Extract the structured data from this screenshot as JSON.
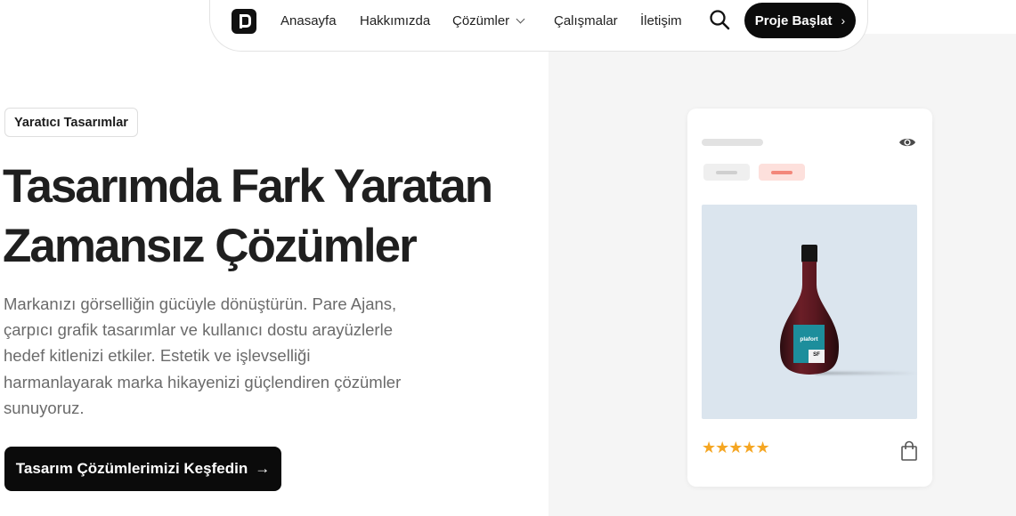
{
  "nav": {
    "links": [
      "Anasayfa",
      "Hakkımızda",
      "Çözümler",
      "Çalışmalar",
      "İletişim"
    ],
    "cta_label": "Proje Başlat",
    "cta_arrow": "›"
  },
  "hero": {
    "badge": "Yaratıcı Tasarımlar",
    "headline_line1": "Tasarımda Fark Yaratan",
    "headline_line2": "Zamansız Çözümler",
    "description": "Markanızı görselliğin gücüyle dönüştürün. Pare Ajans, çarpıcı grafik tasarımlar ve kullanıcı dostu arayüzlerle hedef kitlenizi etkiler. Estetik ve işlevselliği harmanlayarak marka hikayenizi güçlendiren çözümler sunuyoruz.",
    "cta_label": "Tasarım Çözümlerimizi Keşfedin",
    "cta_arrow": "→"
  },
  "card": {
    "bottle_label": "plafort",
    "bottle_sub": "SF",
    "rating": 5,
    "stars": "★★★★★",
    "star_color": "#f5a623",
    "icons": [
      "eye-icon",
      "shopping-bag-icon"
    ]
  },
  "colors": {
    "accent_dark": "#0b0b0b",
    "panel_bg": "#f5f5f5",
    "image_bg": "#dbe5ee",
    "tag_red": "#fde0dc"
  }
}
